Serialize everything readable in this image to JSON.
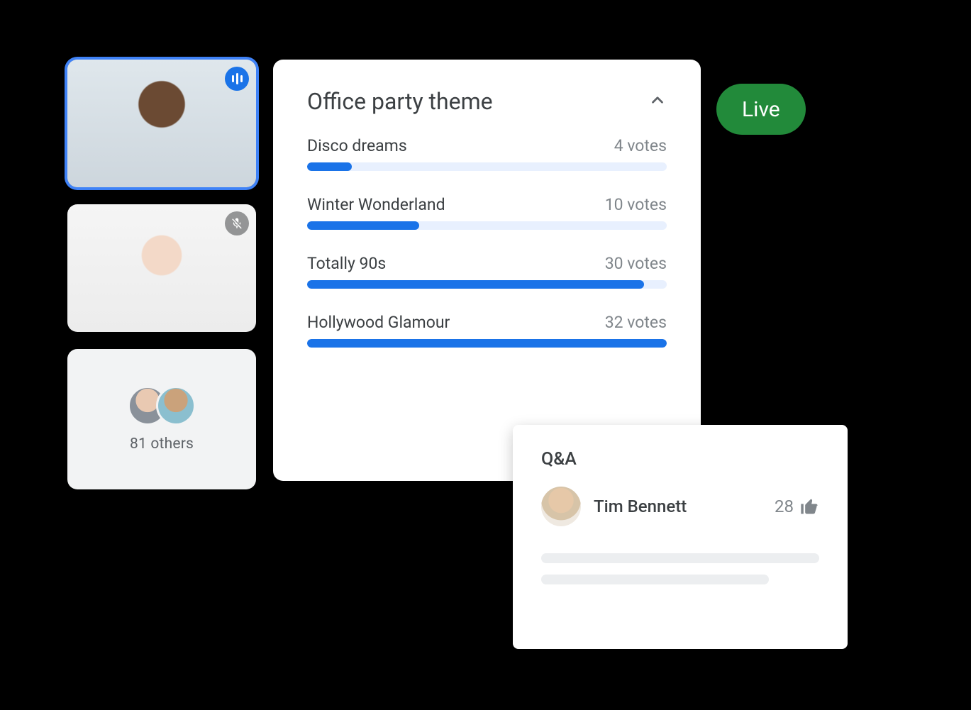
{
  "colors": {
    "accent": "#1a73e8",
    "live": "#228a3a",
    "textPrimary": "#3c4043",
    "textSecondary": "#80868b"
  },
  "participants": {
    "tile1": {
      "state": "speaking",
      "icon": "speaking-icon"
    },
    "tile2": {
      "state": "muted",
      "icon": "mic-off-icon"
    },
    "others": {
      "count_label": "81 others"
    }
  },
  "live_label": "Live",
  "poll": {
    "title": "Office party theme",
    "collapse_icon": "chevron-up-icon",
    "votes_suffix": "votes",
    "max_votes": 32,
    "options": [
      {
        "label": "Disco dreams",
        "votes": 4,
        "votes_label": "4 votes"
      },
      {
        "label": "Winter Wonderland",
        "votes": 10,
        "votes_label": "10 votes"
      },
      {
        "label": "Totally 90s",
        "votes": 30,
        "votes_label": "30 votes"
      },
      {
        "label": "Hollywood Glamour",
        "votes": 32,
        "votes_label": "32 votes"
      }
    ]
  },
  "qa": {
    "title": "Q&A",
    "entry": {
      "name": "Tim Bennett",
      "likes": 28
    }
  },
  "chart_data": {
    "type": "bar",
    "title": "Office party theme",
    "categories": [
      "Disco dreams",
      "Winter Wonderland",
      "Totally 90s",
      "Hollywood Glamour"
    ],
    "values": [
      4,
      10,
      30,
      32
    ],
    "xlabel": "",
    "ylabel": "votes",
    "ylim": [
      0,
      32
    ]
  }
}
